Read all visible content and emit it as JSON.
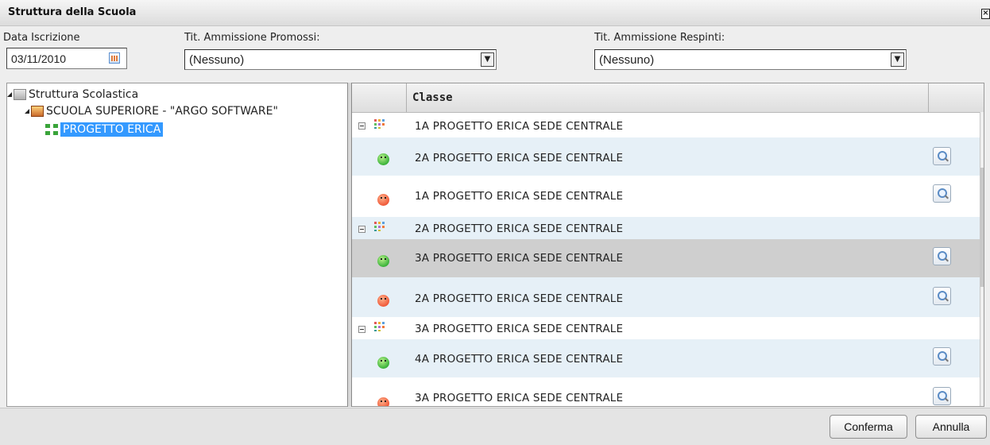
{
  "window": {
    "title": "Struttura della Scuola",
    "close_glyph": "×"
  },
  "form": {
    "data_iscrizione": {
      "label": "Data Iscrizione",
      "value": "03/11/2010"
    },
    "promossi": {
      "label": "Tit. Ammissione Promossi:",
      "selected": "(Nessuno)"
    },
    "respinti": {
      "label": "Tit. Ammissione Respinti:",
      "selected": "(Nessuno)"
    }
  },
  "tree": {
    "root": "Struttura Scolastica",
    "school": "SCUOLA SUPERIORE - \"ARGO SOFTWARE\"",
    "project": "PROGETTO ERICA"
  },
  "grid": {
    "column": "Classe",
    "rows": [
      {
        "type": "group",
        "text": "1A PROGETTO ERICA SEDE CENTRALE"
      },
      {
        "type": "promoted",
        "text": "2A PROGETTO ERICA SEDE CENTRALE"
      },
      {
        "type": "rejected",
        "text": "1A PROGETTO ERICA SEDE CENTRALE"
      },
      {
        "type": "group",
        "text": "2A PROGETTO ERICA SEDE CENTRALE"
      },
      {
        "type": "promoted",
        "text": "3A PROGETTO ERICA SEDE CENTRALE"
      },
      {
        "type": "rejected",
        "text": "2A PROGETTO ERICA SEDE CENTRALE"
      },
      {
        "type": "group",
        "text": "3A PROGETTO ERICA SEDE CENTRALE"
      },
      {
        "type": "promoted",
        "text": "4A PROGETTO ERICA SEDE CENTRALE"
      },
      {
        "type": "rejected",
        "text": "3A PROGETTO ERICA SEDE CENTRALE"
      }
    ]
  },
  "buttons": {
    "confirm": "Conferma",
    "cancel": "Annulla"
  },
  "colors": {
    "selection": "#3399ff",
    "row_alt": "#e6f0f7",
    "row_selected": "#cfcfcf"
  }
}
